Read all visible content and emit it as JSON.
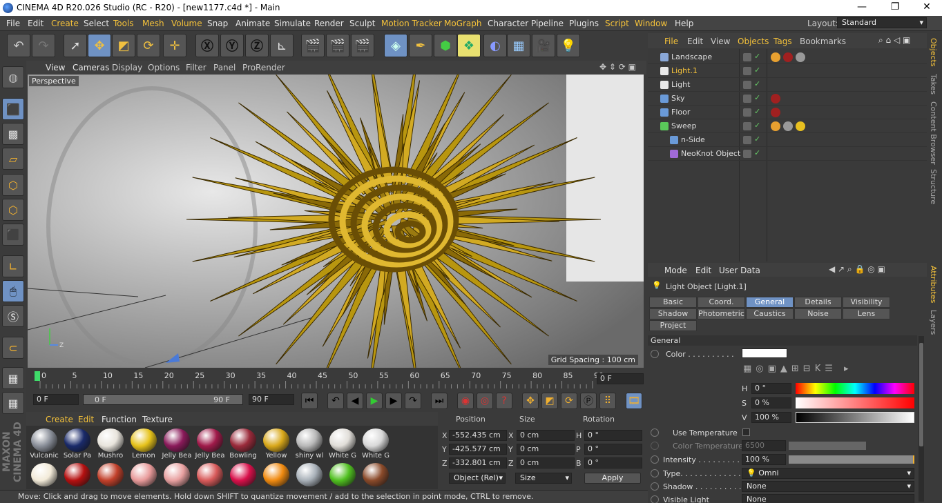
{
  "window": {
    "title": "CINEMA 4D R20.026 Studio (RC - R20) - [new1177.c4d *] - Main",
    "min": "—",
    "max": "❐",
    "close": "✕"
  },
  "menus": [
    "File",
    "Edit",
    "Create",
    "Select",
    "Tools",
    "Mesh",
    "Volume",
    "Snap",
    "Animate",
    "Simulate",
    "Render",
    "Sculpt",
    "Motion Tracker",
    "MoGraph",
    "Character",
    "Pipeline",
    "Plugins",
    "Script",
    "Window",
    "Help"
  ],
  "layout": {
    "label": "Layout:",
    "value": "Standard"
  },
  "viewport": {
    "menu": [
      "View",
      "Cameras",
      "Display",
      "Options",
      "Filter",
      "Panel",
      "ProRender"
    ],
    "camera_label": "Perspective",
    "grid_spacing": "Grid Spacing : 100 cm"
  },
  "timeline": {
    "ticks": [
      "0",
      "5",
      "10",
      "15",
      "20",
      "25",
      "30",
      "35",
      "40",
      "45",
      "50",
      "55",
      "60",
      "65",
      "70",
      "75",
      "80",
      "85",
      "90"
    ],
    "current": "0 F"
  },
  "controls": {
    "start": "0 F",
    "range_start": "0 F",
    "range_end": "90 F",
    "end": "90 F"
  },
  "materials": {
    "menu": [
      "Create",
      "Edit",
      "Function",
      "Texture"
    ],
    "row1": [
      {
        "name": "Vulcanic",
        "color": "#8a8f99"
      },
      {
        "name": "Solar Pa",
        "color": "#1a2a6a"
      },
      {
        "name": "Mushro",
        "color": "#e8e4dc"
      },
      {
        "name": "Lemon",
        "color": "#e6c21a"
      },
      {
        "name": "Jelly Bea",
        "color": "#8a1a5a"
      },
      {
        "name": "Jelly Bea",
        "color": "#a01a4a"
      },
      {
        "name": "Bowling",
        "color": "#9a2a3a"
      },
      {
        "name": "Yellow",
        "color": "#d9a81a"
      },
      {
        "name": "shiny wl",
        "color": "#b8b8b8"
      },
      {
        "name": "White G",
        "color": "#e0ddd8"
      },
      {
        "name": "White G",
        "color": "#d8d8d8"
      }
    ],
    "row2": [
      "#f2ead8",
      "#b51010",
      "#c2402a",
      "#e89a9a",
      "#e8a0a0",
      "#d85a5a",
      "#d8104a",
      "#f08a10",
      "#a8b0b8",
      "#50c020",
      "#8a4a2a"
    ]
  },
  "coords": {
    "headers": [
      "Position",
      "Size",
      "Rotation"
    ],
    "rows": [
      {
        "axis": "X",
        "pos": "-552.435 cm",
        "saxis": "X",
        "size": "0 cm",
        "raxis": "H",
        "rot": "0 °"
      },
      {
        "axis": "Y",
        "pos": "-425.577 cm",
        "saxis": "Y",
        "size": "0 cm",
        "raxis": "P",
        "rot": "0 °"
      },
      {
        "axis": "Z",
        "pos": "-332.801 cm",
        "saxis": "Z",
        "size": "0 cm",
        "raxis": "B",
        "rot": "0 °"
      }
    ],
    "mode": "Object (Rel)",
    "size_mode": "Size",
    "apply": "Apply"
  },
  "status": "Move: Click and drag to move elements. Hold down SHIFT to quantize movement / add to the selection in point mode, CTRL to remove.",
  "objects": {
    "menu": [
      "File",
      "Edit",
      "View",
      "Objects",
      "Tags",
      "Bookmarks"
    ],
    "items": [
      {
        "name": "Landscape",
        "indent": 0,
        "hl": false,
        "color": "#8aa8d8"
      },
      {
        "name": "Light.1",
        "indent": 0,
        "hl": true,
        "color": "#e8e8e8"
      },
      {
        "name": "Light",
        "indent": 0,
        "hl": false,
        "color": "#e8e8e8"
      },
      {
        "name": "Sky",
        "indent": 0,
        "hl": false,
        "color": "#6a9ad8"
      },
      {
        "name": "Floor",
        "indent": 0,
        "hl": false,
        "color": "#6a9ad8"
      },
      {
        "name": "Sweep",
        "indent": 0,
        "hl": false,
        "color": "#5ac85a"
      },
      {
        "name": "n-Side",
        "indent": 1,
        "hl": false,
        "color": "#6a9ad8"
      },
      {
        "name": "NeoKnot Object",
        "indent": 1,
        "hl": false,
        "color": "#a06ad8"
      }
    ]
  },
  "attributes": {
    "menu": [
      "Mode",
      "Edit",
      "User Data"
    ],
    "title": "Light Object [Light.1]",
    "tabs_row1": [
      "Basic",
      "Coord.",
      "General",
      "Details",
      "Visibility"
    ],
    "tabs_row2": [
      "Shadow",
      "Photometric",
      "Caustics",
      "Noise",
      "Lens"
    ],
    "tabs_row3": [
      "Project"
    ],
    "section": "General",
    "color_label": "Color . . . . . . . . . .",
    "h": {
      "label": "H",
      "value": "0 °"
    },
    "s": {
      "label": "S",
      "value": "0 %"
    },
    "v": {
      "label": "V",
      "value": "100 %"
    },
    "use_temp": "Use Temperature",
    "color_temp": {
      "label": "Color Temperature",
      "value": "6500"
    },
    "intensity": {
      "label": "Intensity . . . . . . . . . .",
      "value": "100 %"
    },
    "type": {
      "label": "Type. . . . . . . . . . . . . .",
      "value": "Omni"
    },
    "shadow": {
      "label": "Shadow . . . . . . . . . . .",
      "value": "None"
    },
    "visible_light": {
      "label": "Visible Light",
      "value": "None"
    }
  },
  "side_tabs": [
    "Objects",
    "Takes",
    "Content Browser",
    "Structure",
    "Attributes",
    "Layers"
  ]
}
